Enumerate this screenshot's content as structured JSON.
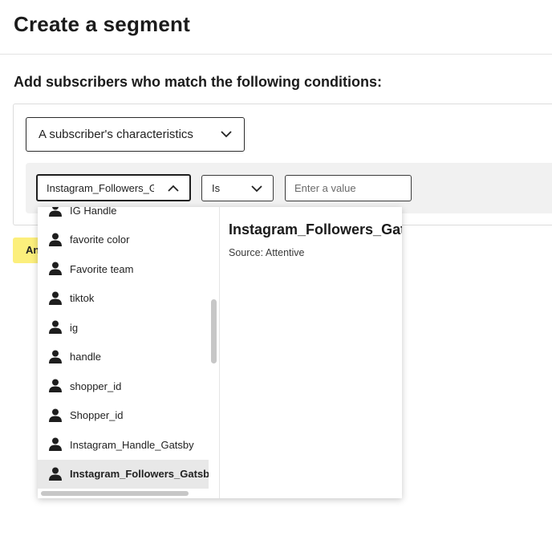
{
  "page": {
    "title": "Create a segment"
  },
  "conditions": {
    "heading": "Add subscribers who match the following conditions:",
    "characteristic_select": "A subscriber's characteristics",
    "attribute_select": "Instagram_Followers_Gatsby",
    "operator_select": "Is",
    "value_input": {
      "value": "",
      "placeholder": "Enter a value"
    },
    "and_button": "And"
  },
  "dropdown": {
    "items": [
      {
        "label": "IG Handle",
        "icon": "person-icon"
      },
      {
        "label": "favorite color",
        "icon": "person-icon"
      },
      {
        "label": "Favorite team",
        "icon": "person-icon"
      },
      {
        "label": "tiktok",
        "icon": "person-icon"
      },
      {
        "label": "ig",
        "icon": "person-icon"
      },
      {
        "label": "handle",
        "icon": "person-icon"
      },
      {
        "label": "shopper_id",
        "icon": "person-icon"
      },
      {
        "label": "Shopper_id",
        "icon": "person-icon"
      },
      {
        "label": "Instagram_Handle_Gatsby",
        "icon": "person-icon"
      },
      {
        "label": "Instagram_Followers_Gatsby",
        "icon": "person-icon",
        "selected": true
      }
    ],
    "detail": {
      "title": "Instagram_Followers_Gatsby",
      "source": "Source: Attentive"
    }
  },
  "colors": {
    "and_button_bg": "#fcef7c",
    "selected_item_bg": "#e8e8e8"
  }
}
